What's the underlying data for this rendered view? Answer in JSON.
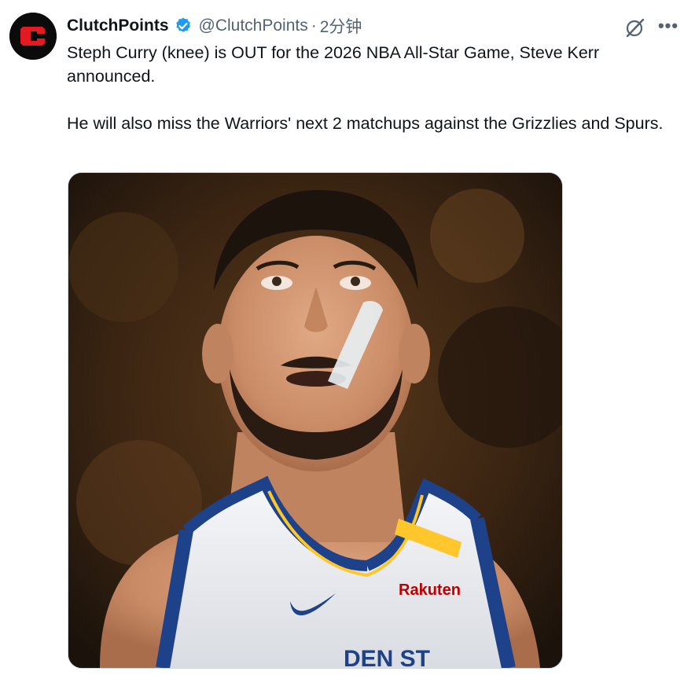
{
  "tweet": {
    "display_name": "ClutchPoints",
    "handle": "@ClutchPoints",
    "separator": "·",
    "time": "2分钟",
    "text_line1": "Steph Curry (knee) is OUT for the 2026 NBA All-Star Game, Steve Kerr announced.",
    "text_line2": "He will also miss the Warriors' next 2 matchups against the Grizzlies and Spurs."
  },
  "icons": {
    "avatar": "clutchpoints-logo",
    "verified": "verified-badge-icon",
    "grok": "grok-icon",
    "more": "more-options-icon"
  },
  "media": {
    "jersey_sponsor": "Rakuten",
    "jersey_text": "DEN ST"
  },
  "colors": {
    "verified": "#1d9bf0",
    "secondary_text": "#536471",
    "logo_red": "#e21b23",
    "jersey_blue": "#1d428a",
    "jersey_gold": "#ffc72c"
  }
}
